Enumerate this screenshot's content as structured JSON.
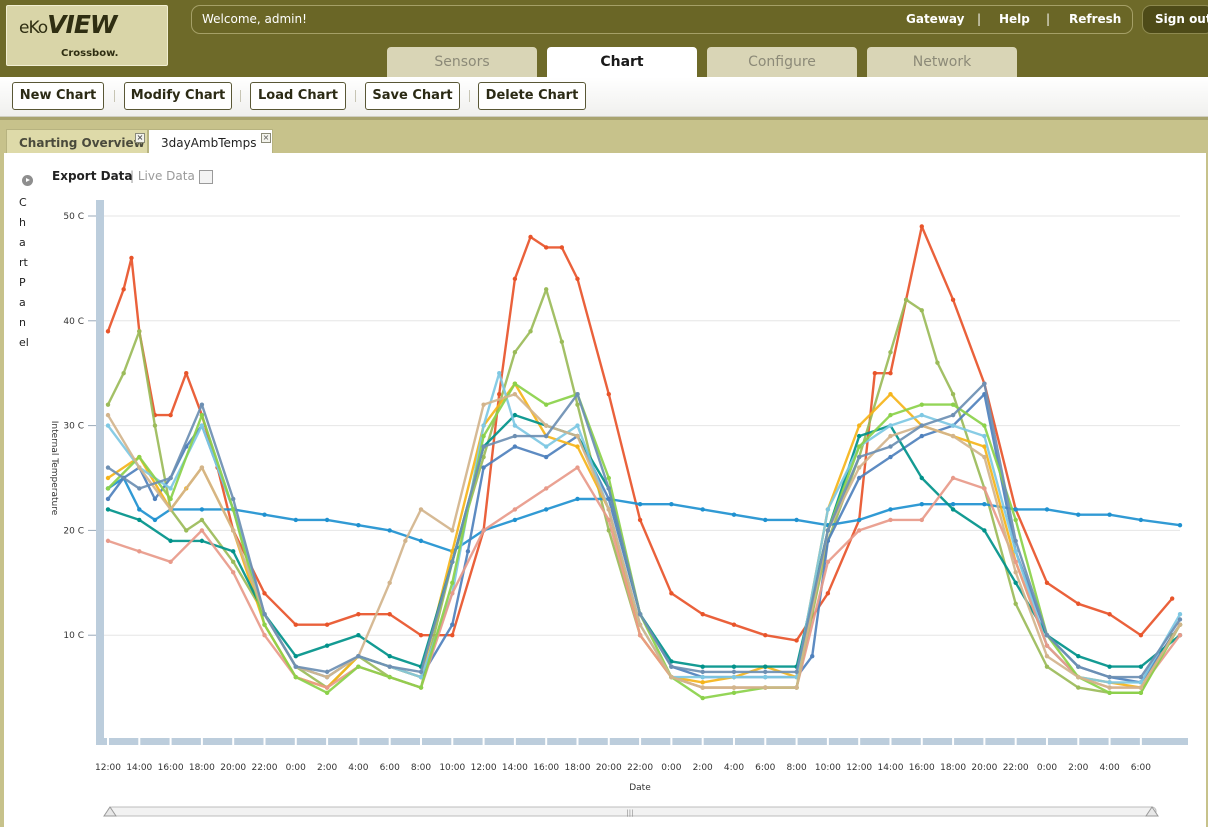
{
  "app": {
    "logo_main": "eKo",
    "logo_view": "VIEW",
    "logo_sub": "Crossbow."
  },
  "header": {
    "welcome": "Welcome, admin!",
    "links": [
      "Gateway",
      "Help",
      "Refresh"
    ],
    "separator": "|",
    "signout": "Sign out"
  },
  "tabs": [
    {
      "label": "Sensors",
      "active": false
    },
    {
      "label": "Chart",
      "active": true
    },
    {
      "label": "Configure",
      "active": false
    },
    {
      "label": "Network",
      "active": false
    }
  ],
  "toolbar": {
    "buttons": [
      "New Chart",
      "Modify Chart",
      "Load Chart",
      "Save Chart",
      "Delete Chart"
    ]
  },
  "chart_tabs": [
    {
      "label": "Charting Overview",
      "active": false
    },
    {
      "label": "3dayAmbTemps",
      "active": true
    }
  ],
  "panel": {
    "label": "Chart Panel",
    "export": "Export Data",
    "live": "| Live Data"
  },
  "chart_data": {
    "type": "line",
    "title": "",
    "xlabel": "Date",
    "ylabel": "Internal Temperature",
    "ylim": [
      0,
      50
    ],
    "yticks": [
      "50 C",
      "40 C",
      "30 C",
      "20 C",
      "10 C"
    ],
    "yvalues": [
      50,
      40,
      30,
      20,
      10
    ],
    "xlim": [
      0,
      68.5
    ],
    "xticks": [
      "12:00",
      "14:00",
      "16:00",
      "18:00",
      "20:00",
      "22:00",
      "0:00",
      "2:00",
      "4:00",
      "6:00",
      "8:00",
      "10:00",
      "12:00",
      "14:00",
      "16:00",
      "18:00",
      "20:00",
      "22:00",
      "0:00",
      "2:00",
      "4:00",
      "6:00",
      "8:00",
      "10:00",
      "12:00",
      "14:00",
      "16:00",
      "18:00",
      "20:00",
      "22:00",
      "0:00",
      "2:00",
      "4:00",
      "6:00"
    ],
    "grid": true,
    "legend": "none",
    "series": [
      {
        "color": "#e8542a",
        "x": [
          0,
          1,
          1.5,
          2,
          3,
          4,
          5,
          6,
          7,
          8,
          10,
          12,
          14,
          16,
          18,
          20,
          22,
          24,
          25,
          26,
          27,
          28,
          29,
          30,
          32,
          34,
          36,
          38,
          40,
          42,
          44,
          46,
          48,
          49,
          50,
          51,
          52,
          54,
          56,
          58,
          60,
          62,
          64,
          66,
          68
        ],
        "y": [
          39,
          43,
          46,
          39,
          31,
          31,
          35,
          31,
          26,
          20,
          14,
          11,
          11,
          12,
          12,
          10,
          10,
          20,
          33,
          44,
          48,
          47,
          47,
          44,
          33,
          21,
          14,
          12,
          11,
          10,
          9.5,
          14,
          21,
          35,
          35,
          42,
          49,
          42,
          34,
          22,
          15,
          13,
          12,
          10,
          13.5
        ]
      },
      {
        "color": "#9bbb59",
        "x": [
          0,
          1,
          2,
          3,
          4,
          5,
          6,
          8,
          10,
          12,
          14,
          16,
          18,
          20,
          22,
          24,
          26,
          27,
          28,
          29,
          30,
          32,
          34,
          36,
          38,
          40,
          42,
          44,
          46,
          48,
          50,
          51,
          52,
          53,
          54,
          56,
          58,
          60,
          62,
          64,
          66,
          68
        ],
        "y": [
          32,
          35,
          39,
          30,
          22,
          20,
          21,
          17,
          12,
          7,
          5,
          8,
          6,
          5,
          17,
          27,
          37,
          39,
          43,
          38,
          32,
          20,
          10,
          6,
          5,
          5,
          5,
          5,
          19,
          27,
          37,
          42,
          41,
          36,
          33,
          24,
          13,
          7,
          5,
          4.5,
          4.5,
          10
        ]
      },
      {
        "color": "#1f91d0",
        "x": [
          0,
          1,
          2,
          3,
          4,
          6,
          8,
          10,
          12,
          14,
          16,
          18,
          20,
          22,
          24,
          26,
          28,
          30,
          32,
          34,
          36,
          38,
          40,
          42,
          44,
          46,
          48,
          50,
          52,
          54,
          56,
          58,
          60,
          62,
          64,
          66,
          68.5
        ],
        "y": [
          24,
          25,
          22,
          21,
          22,
          22,
          22,
          21.5,
          21,
          21,
          20.5,
          20,
          19,
          18,
          20,
          21,
          22,
          23,
          23,
          22.5,
          22.5,
          22,
          21.5,
          21,
          21,
          20.5,
          21,
          22,
          22.5,
          22.5,
          22.5,
          22,
          22,
          21.5,
          21.5,
          21,
          20.5
        ]
      },
      {
        "color": "#4f81bd",
        "x": [
          0,
          1,
          2,
          3,
          4,
          5,
          6,
          8,
          10,
          12,
          14,
          16,
          18,
          20,
          22,
          23,
          24,
          26,
          28,
          30,
          32,
          34,
          36,
          38,
          40,
          42,
          44,
          45,
          46,
          48,
          50,
          52,
          54,
          56,
          58,
          60,
          62,
          64,
          66,
          68.5
        ],
        "y": [
          23,
          25,
          26,
          23,
          25,
          28,
          30,
          22,
          12,
          7,
          6,
          8,
          7,
          6,
          11,
          18,
          26,
          28,
          27,
          29,
          23,
          12,
          7,
          6,
          6,
          6,
          6,
          8,
          19,
          25,
          27,
          29,
          30,
          33,
          18,
          10,
          7,
          6,
          5.5,
          11
        ]
      },
      {
        "color": "#f5b41a",
        "x": [
          0,
          2,
          4,
          5,
          6,
          8,
          10,
          12,
          14,
          16,
          18,
          20,
          22,
          24,
          26,
          28,
          30,
          32,
          34,
          36,
          38,
          40,
          42,
          44,
          46,
          48,
          50,
          52,
          54,
          56,
          58,
          60,
          62,
          64,
          66,
          68.5
        ],
        "y": [
          25,
          27,
          22,
          24,
          26,
          20,
          11,
          6,
          5,
          8,
          7,
          6,
          18,
          30,
          34,
          29,
          28,
          22,
          10,
          6,
          5.5,
          6,
          7,
          6,
          22,
          30,
          33,
          30,
          29,
          28,
          17,
          9,
          6,
          5.5,
          5,
          11
        ]
      },
      {
        "color": "#00928a",
        "x": [
          0,
          2,
          4,
          6,
          8,
          10,
          12,
          14,
          16,
          18,
          20,
          22,
          24,
          26,
          28,
          30,
          32,
          34,
          36,
          38,
          40,
          42,
          44,
          46,
          48,
          50,
          52,
          54,
          56,
          58,
          60,
          62,
          64,
          66,
          68.5
        ],
        "y": [
          22,
          21,
          19,
          19,
          18,
          12,
          8,
          9,
          10,
          8,
          7,
          17,
          28,
          31,
          30,
          29,
          24,
          12,
          7.5,
          7,
          7,
          7,
          7,
          20,
          29,
          30,
          25,
          22,
          20,
          15,
          10,
          8,
          7,
          7,
          10
        ]
      },
      {
        "color": "#7ec8e3",
        "x": [
          0,
          2,
          4,
          6,
          8,
          10,
          12,
          14,
          16,
          18,
          20,
          22,
          24,
          25,
          26,
          28,
          30,
          32,
          34,
          36,
          38,
          40,
          42,
          44,
          46,
          48,
          50,
          52,
          54,
          56,
          58,
          60,
          62,
          64,
          66,
          68.5
        ],
        "y": [
          30,
          26,
          24,
          30,
          22,
          12,
          7,
          6,
          8,
          7,
          6,
          14,
          30,
          35,
          30,
          28,
          30,
          22,
          11,
          6,
          6,
          6,
          6,
          6,
          22,
          28,
          30,
          31,
          30,
          29,
          18,
          9,
          6,
          5.5,
          5.5,
          12
        ]
      },
      {
        "color": "#e89a8a",
        "x": [
          0,
          2,
          4,
          6,
          8,
          10,
          12,
          14,
          16,
          18,
          20,
          22,
          24,
          26,
          28,
          30,
          32,
          34,
          36,
          38,
          40,
          42,
          44,
          46,
          48,
          50,
          52,
          54,
          56,
          58,
          60,
          62,
          64,
          66,
          68.5
        ],
        "y": [
          19,
          18,
          17,
          20,
          16,
          10,
          6,
          5,
          7,
          6,
          5,
          14,
          20,
          22,
          24,
          26,
          21,
          10,
          6,
          5,
          5,
          5,
          5,
          17,
          20,
          21,
          21,
          25,
          24,
          17,
          9,
          6,
          5,
          5,
          10
        ]
      },
      {
        "color": "#8bd14a",
        "x": [
          0,
          2,
          4,
          6,
          8,
          10,
          12,
          14,
          16,
          18,
          20,
          22,
          24,
          26,
          28,
          30,
          32,
          34,
          36,
          38,
          40,
          42,
          44,
          46,
          48,
          50,
          52,
          54,
          56,
          58,
          60,
          62,
          64,
          66,
          68.5
        ],
        "y": [
          24,
          27,
          23,
          31,
          22,
          11,
          6,
          4.5,
          7,
          6,
          5,
          15,
          29,
          34,
          32,
          33,
          25,
          12,
          6,
          4,
          4.5,
          5,
          5,
          20,
          28,
          31,
          32,
          32,
          30,
          21,
          10,
          6,
          4.5,
          4.5,
          11
        ]
      },
      {
        "color": "#d2b48c",
        "x": [
          0,
          2,
          4,
          6,
          8,
          10,
          12,
          14,
          16,
          18,
          19,
          20,
          22,
          24,
          26,
          28,
          30,
          32,
          34,
          36,
          38,
          40,
          42,
          44,
          46,
          48,
          50,
          52,
          54,
          56,
          58,
          60,
          62,
          64,
          66,
          68.5
        ],
        "y": [
          31,
          26,
          22,
          26,
          20,
          12,
          7,
          6,
          8,
          15,
          19,
          22,
          20,
          32,
          33,
          30,
          29,
          22,
          11,
          6,
          5,
          5,
          5,
          5,
          20,
          26,
          29,
          30,
          29,
          27,
          16,
          8,
          6,
          5,
          5,
          11
        ]
      },
      {
        "color": "#6d8fb3",
        "x": [
          0,
          2,
          4,
          6,
          8,
          10,
          12,
          14,
          16,
          18,
          20,
          22,
          24,
          26,
          28,
          30,
          32,
          34,
          36,
          38,
          40,
          42,
          44,
          46,
          48,
          50,
          52,
          54,
          56,
          58,
          60,
          62,
          64,
          66,
          68.5
        ],
        "y": [
          26,
          24,
          25,
          32,
          23,
          12,
          7,
          6.5,
          8,
          7,
          6.5,
          17,
          28,
          29,
          29,
          33,
          24,
          12,
          7,
          6.5,
          6.5,
          6.5,
          6.5,
          20,
          27,
          28,
          30,
          31,
          34,
          19,
          10,
          7,
          6,
          6,
          11.5
        ]
      }
    ]
  }
}
